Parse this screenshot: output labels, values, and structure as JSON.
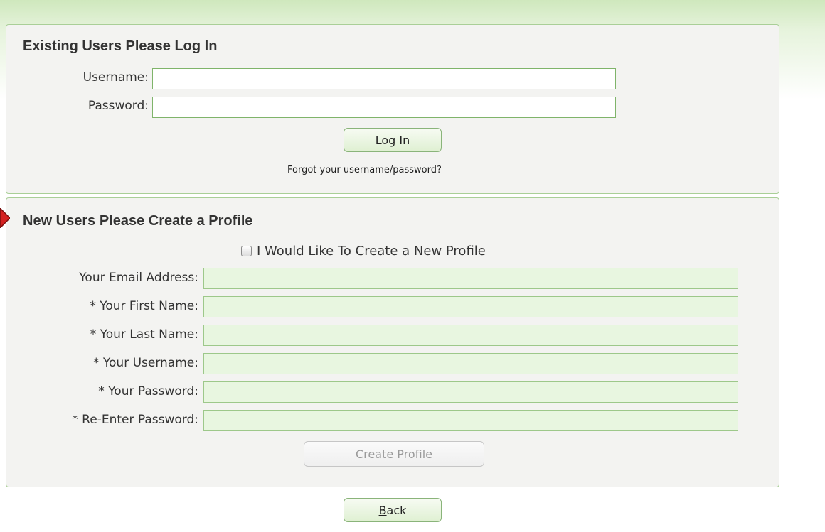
{
  "login": {
    "title": "Existing Users Please Log In",
    "username_label": "Username:",
    "username_value": "",
    "password_label": "Password:",
    "password_value": "",
    "login_button": "Log In",
    "forgot_link": "Forgot your username/password?"
  },
  "create": {
    "title": "New Users Please Create a Profile",
    "checkbox_label": "I Would Like To Create a New Profile",
    "checkbox_checked": false,
    "fields": [
      {
        "label": "Your Email Address:",
        "value": ""
      },
      {
        "label": "* Your First Name:",
        "value": ""
      },
      {
        "label": "* Your Last Name:",
        "value": ""
      },
      {
        "label": "* Your Username:",
        "value": ""
      },
      {
        "label": "* Your Password:",
        "value": ""
      },
      {
        "label": "* Re-Enter Password:",
        "value": ""
      }
    ],
    "create_button": "Create Profile"
  },
  "back_button": {
    "first": "B",
    "rest": "ack"
  },
  "colors": {
    "panel_bg": "#f3f3f1",
    "panel_border": "#a9cf97",
    "field_green_bg": "#e8f6e0",
    "marker_red": "#d42020"
  },
  "icons": {
    "marker": "red-arrow-marker-icon"
  }
}
